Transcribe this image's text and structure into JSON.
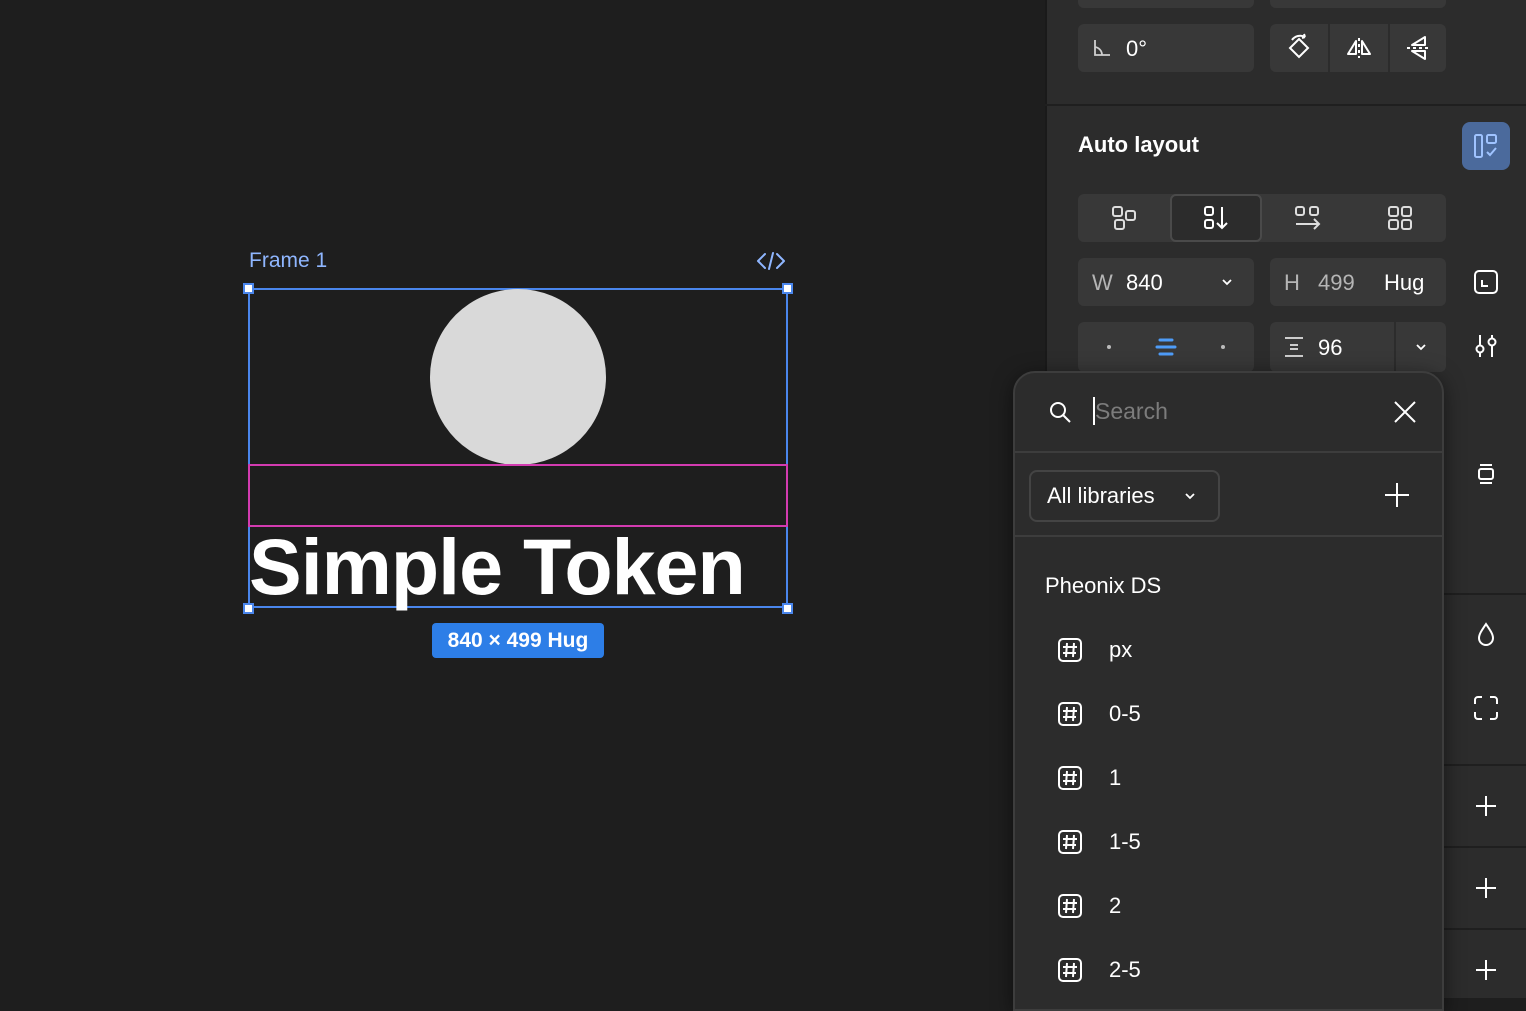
{
  "canvas": {
    "frame_label": "Frame 1",
    "text_content": "Simple Token",
    "size_badge": "840 × 499 Hug"
  },
  "panel": {
    "rotation_value": "0°",
    "auto_layout_title": "Auto layout",
    "width_label": "W",
    "width_value": "840",
    "height_label": "H",
    "height_value": "499",
    "height_mode": "Hug",
    "gap_value": "96"
  },
  "popup": {
    "search_placeholder": "Search",
    "library_select": "All libraries",
    "group_title": "Pheonix DS",
    "tokens": [
      {
        "label": "px"
      },
      {
        "label": "0-5"
      },
      {
        "label": "1"
      },
      {
        "label": "1-5"
      },
      {
        "label": "2"
      },
      {
        "label": "2-5"
      }
    ]
  },
  "colors": {
    "selection": "#4a86ec",
    "accent_pink": "#d33bb0",
    "canvas_bg": "#1e1e1e",
    "panel_bg": "#2c2c2c"
  }
}
